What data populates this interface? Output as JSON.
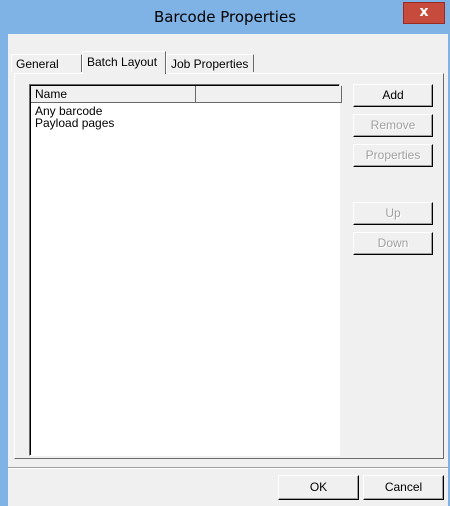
{
  "window": {
    "title": "Barcode Properties",
    "close_glyph": "x"
  },
  "tabs": [
    {
      "label": "General",
      "active": false
    },
    {
      "label": "Batch Layout",
      "active": true
    },
    {
      "label": "Job Properties",
      "active": false
    }
  ],
  "list": {
    "columns": [
      "Name",
      ""
    ],
    "items": [
      "Any barcode",
      "Payload pages"
    ]
  },
  "side_buttons": {
    "add": "Add",
    "remove": "Remove",
    "properties": "Properties",
    "up": "Up",
    "down": "Down"
  },
  "footer": {
    "ok": "OK",
    "cancel": "Cancel"
  },
  "colors": {
    "titlebar": "#7fb2e5",
    "close_button": "#c74b3d",
    "dialog_face": "#f0f0f0",
    "disabled_text": "#a0a0a0"
  }
}
